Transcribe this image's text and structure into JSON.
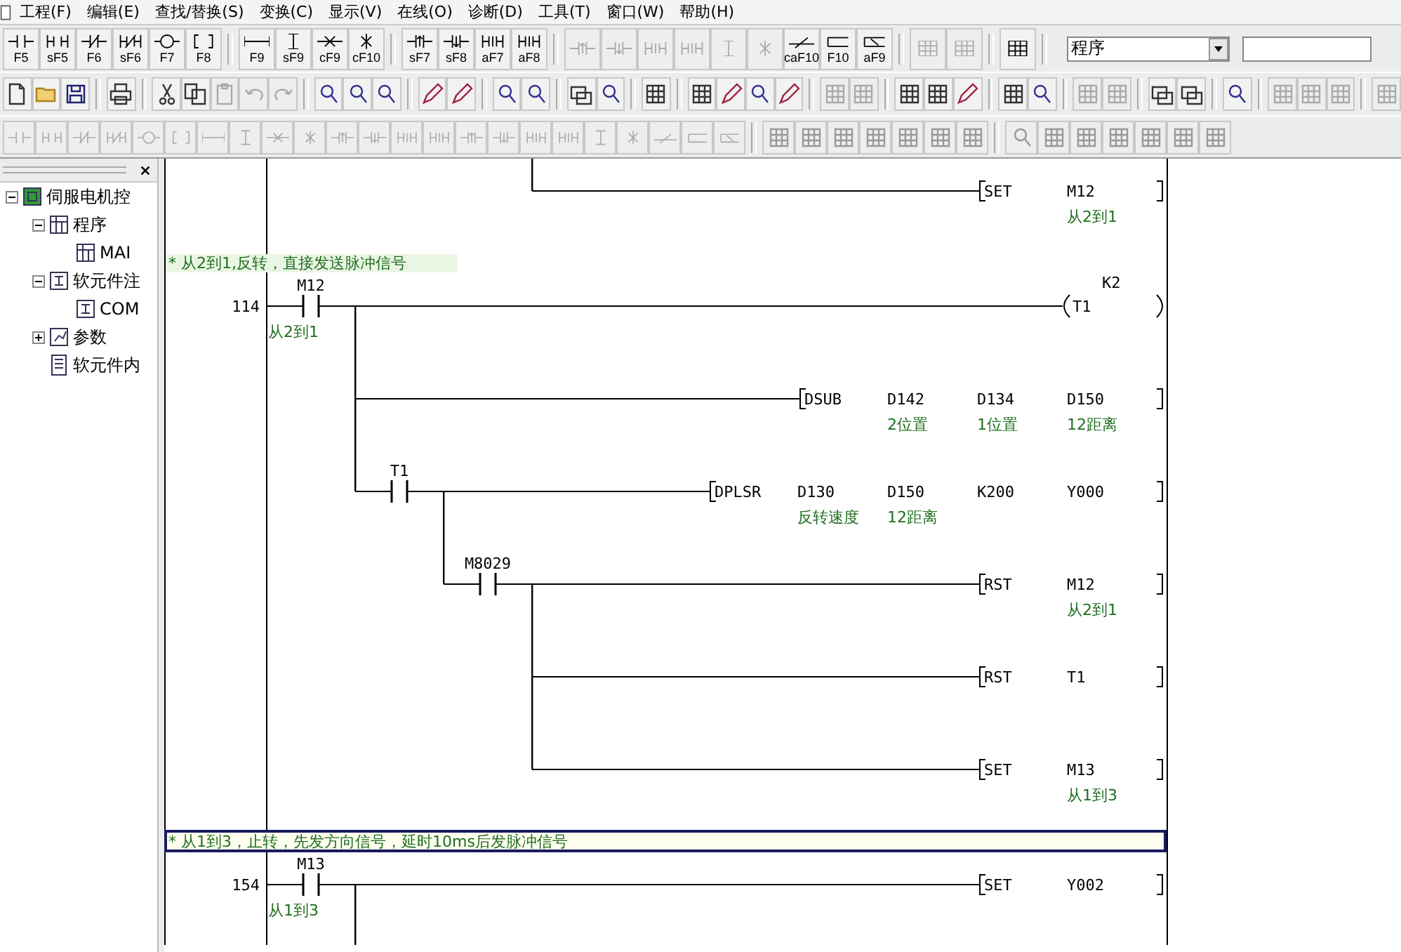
{
  "menu": [
    "工程(F)",
    "编辑(E)",
    "查找/替换(S)",
    "变换(C)",
    "显示(V)",
    "在线(O)",
    "诊断(D)",
    "工具(T)",
    "窗口(W)",
    "帮助(H)"
  ],
  "toolbar_1": {
    "buttons": [
      {
        "key": "F5",
        "kind": "contact",
        "disabled": false
      },
      {
        "key": "sF5",
        "kind": "contact_parallel",
        "disabled": false
      },
      {
        "key": "F6",
        "kind": "contact_nc",
        "disabled": false
      },
      {
        "key": "sF6",
        "kind": "contact_nc_parallel",
        "disabled": false
      },
      {
        "key": "F7",
        "kind": "coil",
        "disabled": false
      },
      {
        "key": "F8",
        "kind": "instruction",
        "disabled": false,
        "separator_after": true
      },
      {
        "key": "F9",
        "kind": "hline",
        "disabled": false
      },
      {
        "key": "sF9",
        "kind": "vline",
        "disabled": false
      },
      {
        "key": "cF9",
        "kind": "hline_delete",
        "disabled": false
      },
      {
        "key": "cF10",
        "kind": "vline_delete",
        "disabled": false,
        "separator_after": true
      },
      {
        "key": "sF7",
        "kind": "pulse",
        "disabled": false
      },
      {
        "key": "sF8",
        "kind": "pulse_fall",
        "disabled": false
      },
      {
        "key": "aF7",
        "kind": "pulse_parallel",
        "disabled": false
      },
      {
        "key": "aF8",
        "kind": "pulse_parallel",
        "disabled": false,
        "separator_after": true
      },
      {
        "kind": "pulse",
        "disabled": true
      },
      {
        "kind": "pulse_fall",
        "disabled": true
      },
      {
        "kind": "pulse_parallel",
        "disabled": true
      },
      {
        "kind": "pulse_parallel",
        "disabled": true
      },
      {
        "kind": "vline",
        "disabled": true
      },
      {
        "kind": "vline_delete",
        "disabled": true
      },
      {
        "key": "caF10",
        "kind": "invert",
        "disabled": false
      },
      {
        "key": "F10",
        "kind": "line",
        "disabled": false
      },
      {
        "key": "aF9",
        "kind": "line_delete",
        "disabled": false,
        "separator_after": true
      },
      {
        "kind": "grid",
        "disabled": true
      },
      {
        "kind": "grid",
        "disabled": true,
        "separator_after": true
      },
      {
        "kind": "grid",
        "disabled": false,
        "separator_after": true
      }
    ],
    "mode_select": {
      "value": "程序"
    }
  },
  "toolbar_2": {
    "buttons": [
      {
        "kind": "document",
        "disabled": false
      },
      {
        "kind": "folder",
        "disabled": false
      },
      {
        "kind": "floppy",
        "disabled": false,
        "separator_after": true
      },
      {
        "kind": "printer",
        "disabled": false,
        "separator_after": true
      },
      {
        "kind": "scissors",
        "disabled": false
      },
      {
        "kind": "copy",
        "disabled": false
      },
      {
        "kind": "paste",
        "disabled": true
      },
      {
        "kind": "undo",
        "disabled": true
      },
      {
        "kind": "redo",
        "disabled": true,
        "separator_after": true
      },
      {
        "kind": "magnifier",
        "disabled": false
      },
      {
        "kind": "magnifier",
        "disabled": false
      },
      {
        "kind": "magnifier",
        "disabled": false,
        "separator_after": true
      },
      {
        "kind": "pencil",
        "disabled": false
      },
      {
        "kind": "pencil",
        "disabled": false,
        "separator_after": true
      },
      {
        "kind": "magnifier",
        "disabled": false
      },
      {
        "kind": "magnifier",
        "disabled": false,
        "separator_after": true
      },
      {
        "kind": "window",
        "disabled": false
      },
      {
        "kind": "magnifier",
        "disabled": false,
        "separator_after": true
      },
      {
        "kind": "grid",
        "disabled": false,
        "separator_after": true
      },
      {
        "kind": "grid",
        "disabled": false
      },
      {
        "kind": "pencil",
        "disabled": false
      },
      {
        "kind": "magnifier",
        "disabled": false
      },
      {
        "kind": "pencil",
        "disabled": false,
        "separator_after": true
      },
      {
        "kind": "grid",
        "disabled": true
      },
      {
        "kind": "grid",
        "disabled": true,
        "separator_after": true
      },
      {
        "kind": "grid",
        "disabled": false
      },
      {
        "kind": "grid",
        "disabled": false
      },
      {
        "kind": "pencil",
        "disabled": false,
        "separator_after": true
      },
      {
        "kind": "grid",
        "disabled": false
      },
      {
        "kind": "magnifier",
        "disabled": false,
        "separator_after": true
      },
      {
        "kind": "grid",
        "disabled": true
      },
      {
        "kind": "grid",
        "disabled": true,
        "separator_after": true
      },
      {
        "kind": "window",
        "disabled": false
      },
      {
        "kind": "window",
        "disabled": false,
        "separator_after": true
      },
      {
        "kind": "magnifier",
        "disabled": false,
        "separator_after": true
      },
      {
        "kind": "grid",
        "disabled": true
      },
      {
        "kind": "grid",
        "disabled": true
      },
      {
        "kind": "grid",
        "disabled": true,
        "separator_after": true
      },
      {
        "kind": "grid",
        "disabled": true
      }
    ]
  },
  "toolbar_3": {
    "buttons": [
      {
        "kind": "contact",
        "disabled": true
      },
      {
        "kind": "contact_parallel",
        "disabled": true
      },
      {
        "kind": "contact_nc",
        "disabled": true
      },
      {
        "kind": "contact_nc_parallel",
        "disabled": true
      },
      {
        "kind": "coil",
        "disabled": true
      },
      {
        "kind": "instruction",
        "disabled": true
      },
      {
        "kind": "hline",
        "disabled": true
      },
      {
        "kind": "vline",
        "disabled": true
      },
      {
        "kind": "hline_delete",
        "disabled": true
      },
      {
        "kind": "vline_delete",
        "disabled": true
      },
      {
        "kind": "pulse",
        "disabled": true
      },
      {
        "kind": "pulse_fall",
        "disabled": true
      },
      {
        "kind": "pulse_parallel",
        "disabled": true
      },
      {
        "kind": "pulse_parallel",
        "disabled": true
      },
      {
        "kind": "pulse",
        "disabled": true
      },
      {
        "kind": "pulse_fall",
        "disabled": true
      },
      {
        "kind": "pulse_parallel",
        "disabled": true
      },
      {
        "kind": "pulse_parallel",
        "disabled": true
      },
      {
        "kind": "vline",
        "disabled": true
      },
      {
        "kind": "vline_delete",
        "disabled": true
      },
      {
        "kind": "invert",
        "disabled": true
      },
      {
        "kind": "line",
        "disabled": true
      },
      {
        "kind": "line_delete",
        "disabled": true,
        "separator_after": true
      },
      {
        "kind": "grid",
        "disabled": true
      },
      {
        "kind": "grid",
        "disabled": true
      },
      {
        "kind": "grid",
        "disabled": true
      },
      {
        "kind": "grid",
        "disabled": true
      },
      {
        "kind": "grid",
        "disabled": true
      },
      {
        "kind": "grid",
        "disabled": true
      },
      {
        "kind": "grid",
        "disabled": true,
        "separator_after": true
      },
      {
        "kind": "magnifier",
        "disabled": true
      },
      {
        "kind": "grid",
        "disabled": true
      },
      {
        "kind": "grid",
        "disabled": true
      },
      {
        "kind": "grid",
        "disabled": true
      },
      {
        "kind": "grid",
        "disabled": true
      },
      {
        "kind": "grid",
        "disabled": true
      },
      {
        "kind": "grid",
        "disabled": true
      }
    ]
  },
  "tree": {
    "items": [
      {
        "label": "伺服电机控",
        "kind": "project",
        "expanded": true,
        "selected": false,
        "children": [
          {
            "label": "程序",
            "kind": "program",
            "expanded": true,
            "selected": false,
            "children": [
              {
                "label": "MAI",
                "kind": "program",
                "selected": false
              }
            ]
          },
          {
            "label": "软元件注",
            "kind": "comment",
            "expanded": true,
            "selected": false,
            "children": [
              {
                "label": "COM",
                "kind": "comment",
                "selected": false
              }
            ]
          },
          {
            "label": "参数",
            "kind": "parameter",
            "expanded": false,
            "selected": false
          },
          {
            "label": "软元件内",
            "kind": "memory",
            "selected": false
          }
        ]
      }
    ]
  },
  "ladder": {
    "rungs": [
      {
        "continued_from_above": true,
        "node": {
          "children": [
            {
              "children": [
                {
                  "children": [
                    {
                      "output": {
                        "kind": "instruction",
                        "name": "SET",
                        "operands": [
                          {
                            "device": "M12",
                            "comment": "从2到1"
                          }
                        ]
                      }
                    }
                  ]
                }
              ]
            }
          ]
        }
      },
      {
        "comment": "* 从2到1,反转，直接发送脉冲信号",
        "comment_selected": false,
        "step": "114",
        "node": {
          "contact": {
            "device": "M12",
            "comment": "从2到1"
          },
          "children": [
            {
              "output": {
                "kind": "coil",
                "device": "T1",
                "setting": "K2"
              }
            },
            {
              "output": {
                "kind": "instruction",
                "name": "DSUB",
                "operands": [
                  {
                    "device": "D142",
                    "comment": "2位置"
                  },
                  {
                    "device": "D134",
                    "comment": "1位置"
                  },
                  {
                    "device": "D150",
                    "comment": "12距离"
                  }
                ]
              }
            },
            {
              "contact": {
                "device": "T1"
              },
              "children": [
                {
                  "output": {
                    "kind": "instruction",
                    "name": "DPLSR",
                    "operands": [
                      {
                        "device": "D130",
                        "comment": "反转速度"
                      },
                      {
                        "device": "D150",
                        "comment": "12距离"
                      },
                      {
                        "device": "K200"
                      },
                      {
                        "device": "Y000"
                      }
                    ]
                  }
                },
                {
                  "contact": {
                    "device": "M8029"
                  },
                  "children": [
                    {
                      "output": {
                        "kind": "instruction",
                        "name": "RST",
                        "operands": [
                          {
                            "device": "M12",
                            "comment": "从2到1"
                          }
                        ]
                      }
                    },
                    {
                      "output": {
                        "kind": "instruction",
                        "name": "RST",
                        "operands": [
                          {
                            "device": "T1"
                          }
                        ]
                      }
                    },
                    {
                      "output": {
                        "kind": "instruction",
                        "name": "SET",
                        "operands": [
                          {
                            "device": "M13",
                            "comment": "从1到3"
                          }
                        ]
                      }
                    }
                  ]
                }
              ]
            }
          ]
        }
      },
      {
        "comment": "* 从1到3，止转，先发方向信号，延时10ms后发脉冲信号",
        "comment_selected": true,
        "step": "154",
        "node": {
          "contact": {
            "device": "M13",
            "comment": "从1到3"
          },
          "continues_below": true,
          "children": [
            {
              "output": {
                "kind": "instruction",
                "name": "SET",
                "operands": [
                  {
                    "device": "Y002"
                  }
                ]
              }
            }
          ]
        }
      }
    ]
  }
}
